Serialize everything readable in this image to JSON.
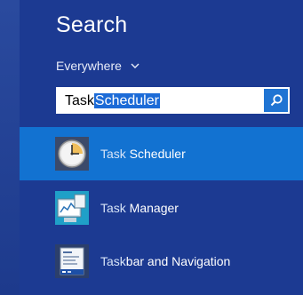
{
  "search": {
    "title": "Search",
    "scope_label": "Everywhere",
    "query_typed": "Task",
    "query_autocomplete": "Scheduler"
  },
  "results": [
    {
      "prefix": "Task",
      "rest": " Scheduler",
      "icon": "task-scheduler-clock-icon",
      "selected": true
    },
    {
      "prefix": "Task",
      "rest": " Manager",
      "icon": "task-manager-icon",
      "selected": false
    },
    {
      "prefix": "Task",
      "rest": "bar and Navigation",
      "icon": "taskbar-navigation-icon",
      "selected": false
    }
  ],
  "colors": {
    "background": "#1c3a92",
    "selected": "#1272d1",
    "search_button": "#1f74d3"
  }
}
